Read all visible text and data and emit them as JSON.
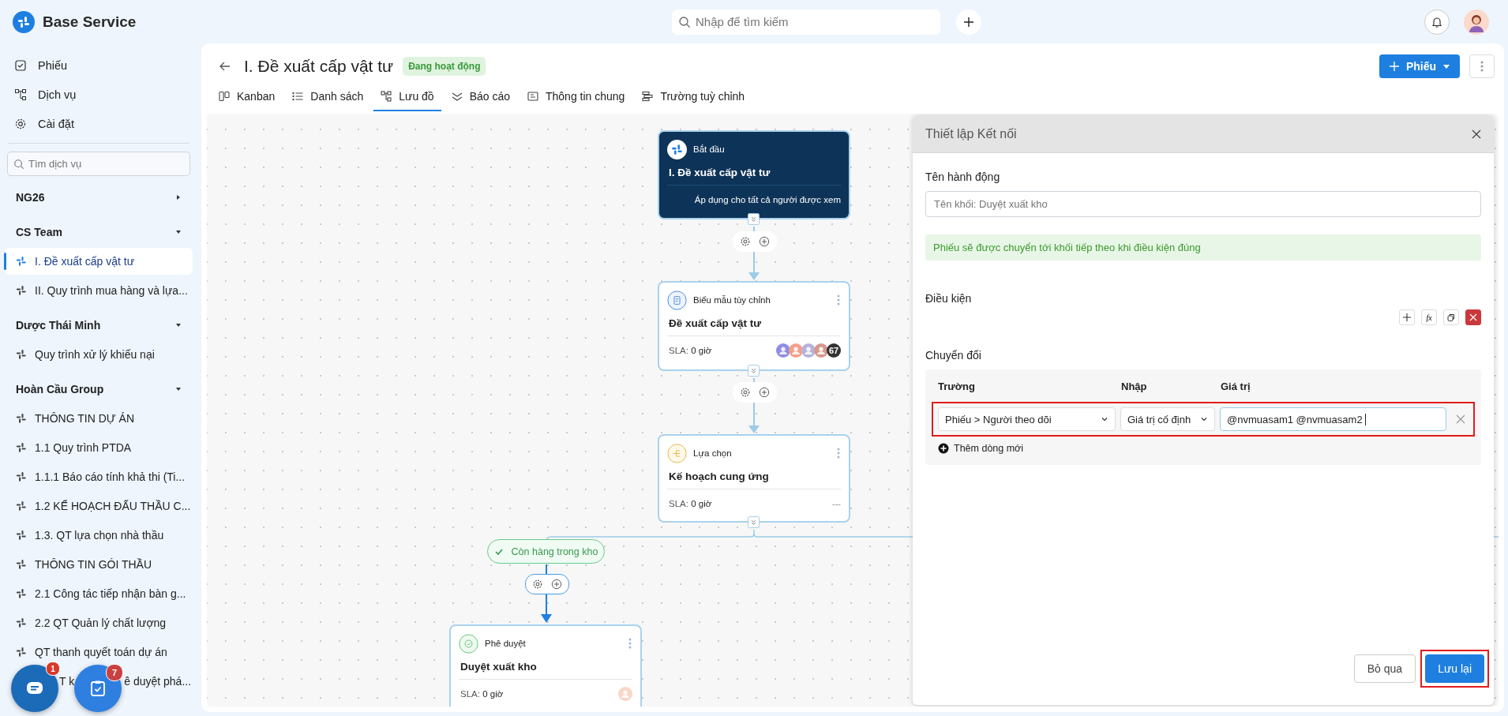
{
  "app": {
    "name": "Base Service"
  },
  "topbar": {
    "search": {
      "placeholder": "Nhập để tìm kiếm"
    }
  },
  "sidebar": {
    "nav": [
      {
        "label": "Phiếu"
      },
      {
        "label": "Dịch vụ"
      },
      {
        "label": "Cài đặt"
      }
    ],
    "search": {
      "placeholder": "Tìm dịch vụ"
    },
    "groups": [
      {
        "name": "NG26",
        "expanded": false
      },
      {
        "name": "CS Team",
        "expanded": true,
        "items": [
          {
            "label": "I. Đề xuất cấp vật tư",
            "selected": true
          },
          {
            "label": "II. Quy trình mua hàng và lựa...",
            "selected": false
          }
        ]
      },
      {
        "name": "Dược Thái Minh",
        "expanded": true,
        "items": [
          {
            "label": "Quy trình xử lý khiếu nại",
            "selected": false
          }
        ]
      },
      {
        "name": "Hoàn Cầu Group",
        "expanded": true,
        "items": [
          {
            "label": "THÔNG TIN DỰ ÁN",
            "selected": false
          },
          {
            "label": "1.1 Quy trình PTDA",
            "selected": false
          },
          {
            "label": "1.1.1 Báo cáo tính khả thi (Ti...",
            "selected": false
          },
          {
            "label": "1.2 KẾ HOẠCH ĐẤU THẦU C...",
            "selected": false
          },
          {
            "label": "1.3. QT lựa chọn nhà thầu",
            "selected": false
          },
          {
            "label": "THÔNG TIN GÓI THẦU",
            "selected": false
          },
          {
            "label": "2.1 Công tác tiếp nhận bàn g...",
            "selected": false
          },
          {
            "label": "2.2 QT Quản lý chất lượng",
            "selected": false
          },
          {
            "label": "QT thanh quyết toán dự án",
            "selected": false
          },
          {
            "fragments": [
              "T k",
              "ê duyệt phá..."
            ],
            "selected": false
          }
        ]
      }
    ]
  },
  "fabs": [
    {
      "badge": "1"
    },
    {
      "badge": "7"
    }
  ],
  "page": {
    "title": "I. Đề xuất cấp vật tư",
    "status": "Đang hoạt động",
    "new_button": "Phiếu"
  },
  "tabs": [
    {
      "label": "Kanban",
      "selected": false
    },
    {
      "label": "Danh sách",
      "selected": false
    },
    {
      "label": "Lưu đồ",
      "selected": true
    },
    {
      "label": "Báo cáo",
      "selected": false
    },
    {
      "label": "Thông tin chung",
      "selected": false
    },
    {
      "label": "Trường tuỳ chỉnh",
      "selected": false
    }
  ],
  "flow": {
    "nodes": [
      {
        "kind": "start",
        "type": "Bắt đầu",
        "title": "I. Đề xuất cấp vật tư",
        "note": "Áp dụng cho tất cả người được xem"
      },
      {
        "kind": "form",
        "type": "Biểu mẫu tùy chỉnh",
        "title": "Đề xuất cấp vật tư",
        "sla_label": "SLA:",
        "sla": "0 giờ",
        "avatars": [
          {
            "color": "#8f8de4"
          },
          {
            "color": "#f3a08a"
          },
          {
            "color": "#b6b2dd"
          },
          {
            "color": "#d7988e"
          }
        ],
        "more": "67"
      },
      {
        "kind": "choice",
        "type": "Lựa chọn",
        "title": "Kế hoạch cung ứng",
        "sla_label": "SLA:",
        "sla": "0 giờ",
        "assignees_text": "---"
      },
      {
        "kind": "approval",
        "type": "Phê duyệt",
        "title": "Duyệt xuất kho",
        "sla_label": "SLA:",
        "sla": "0 giờ",
        "avatars": [
          {
            "color": "#f9d6c8"
          }
        ]
      }
    ],
    "connections": [
      {
        "selected": false
      },
      {
        "selected": false
      },
      {
        "label": "Còn hàng trong kho",
        "selected": true
      }
    ]
  },
  "panel": {
    "title": "Thiết lập Kết nối",
    "name_label": "Tên hành động",
    "name_placeholder": "Tên khối: Duyệt xuất kho",
    "notice": "Phiếu sẽ được chuyển tới khối tiếp theo khi điều kiện đúng",
    "condition_label": "Điều kiện",
    "formula_button": "fx",
    "transform_label": "Chuyển đổi",
    "columns": [
      "Trường",
      "Nhập",
      "Giá trị"
    ],
    "rows": [
      {
        "field": "Phiếu > Người theo dõi",
        "input": "Giá trị cố định",
        "value": "@nvmuasam1 @nvmuasam2",
        "highlighted": true
      }
    ],
    "add_row": "Thêm dòng mới",
    "cancel": "Bỏ qua",
    "save": "Lưu lại",
    "save_highlighted": true
  }
}
